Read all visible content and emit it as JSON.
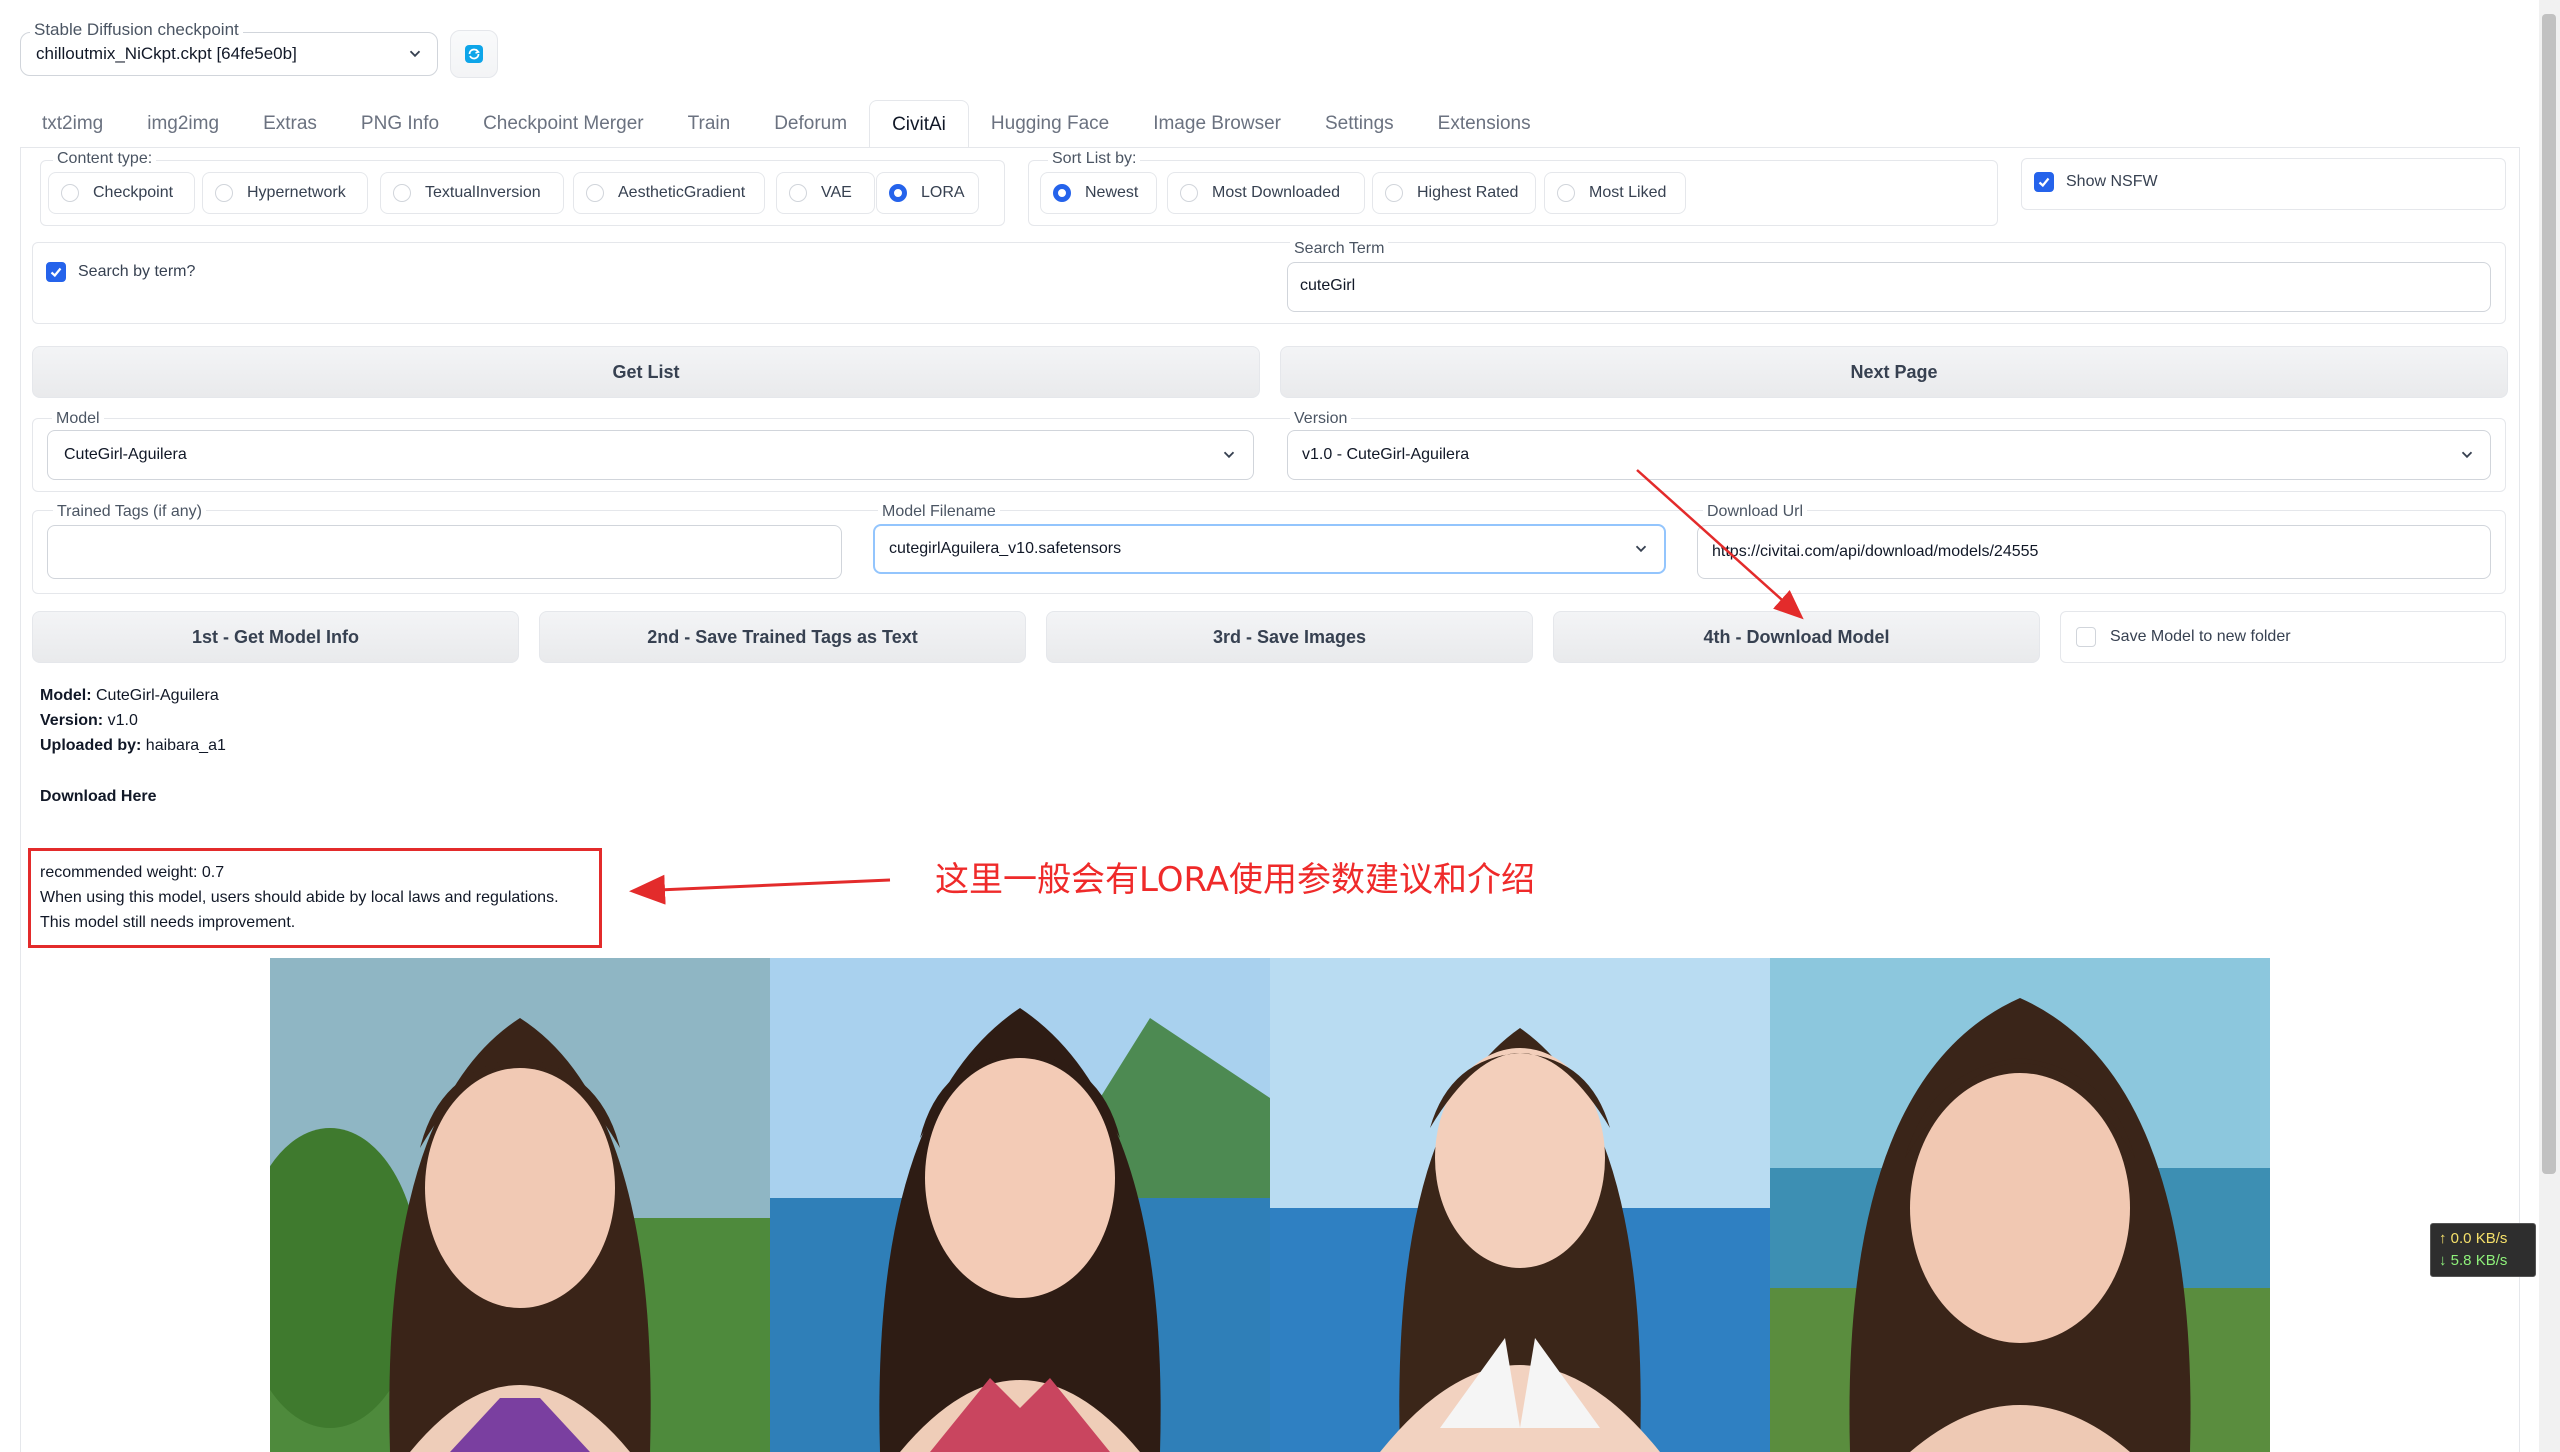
{
  "checkpoint": {
    "label": "Stable Diffusion checkpoint",
    "value": "chilloutmix_NiCkpt.ckpt [64fe5e0b]"
  },
  "tabs": [
    "txt2img",
    "img2img",
    "Extras",
    "PNG Info",
    "Checkpoint Merger",
    "Train",
    "Deforum",
    "CivitAi",
    "Hugging Face",
    "Image Browser",
    "Settings",
    "Extensions"
  ],
  "active_tab": "CivitAi",
  "content_type": {
    "label": "Content type:",
    "options": [
      "Checkpoint",
      "Hypernetwork",
      "TextualInversion",
      "AestheticGradient",
      "VAE",
      "LORA"
    ],
    "selected": "LORA"
  },
  "sort": {
    "label": "Sort List by:",
    "options": [
      "Newest",
      "Most Downloaded",
      "Highest Rated",
      "Most Liked"
    ],
    "selected": "Newest"
  },
  "show_nsfw": {
    "label": "Show NSFW",
    "checked": true
  },
  "search_by_term": {
    "label": "Search by term?",
    "checked": true
  },
  "search_term": {
    "label": "Search Term",
    "value": "cuteGirl"
  },
  "buttons": {
    "get_list": "Get List",
    "next_page": "Next Page"
  },
  "model": {
    "label": "Model",
    "value": "CuteGirl-Aguilera"
  },
  "version": {
    "label": "Version",
    "value": "v1.0 - CuteGirl-Aguilera"
  },
  "trained_tags": {
    "label": "Trained Tags (if any)",
    "value": ""
  },
  "model_filename": {
    "label": "Model Filename",
    "value": "cutegirlAguilera_v10.safetensors"
  },
  "download_url": {
    "label": "Download Url",
    "value": "https://civitai.com/api/download/models/24555"
  },
  "steps": {
    "step1": "1st - Get Model Info",
    "step2": "2nd - Save Trained Tags as Text",
    "step3": "3rd - Save Images",
    "step4": "4th - Download Model"
  },
  "save_new_folder": {
    "label": "Save Model to new folder",
    "checked": false
  },
  "model_info": {
    "model_key": "Model:",
    "model_val": "CuteGirl-Aguilera",
    "version_key": "Version:",
    "version_val": "v1.0",
    "uploader_key": "Uploaded by:",
    "uploader_val": "haibara_a1",
    "download_link": "Download Here"
  },
  "description": {
    "line1": "recommended weight: 0.7",
    "line2": "When using this model, users should abide by local laws and regulations.",
    "line3": "This model still needs improvement."
  },
  "annotation": "这里一般会有LORA使用参数建议和介绍",
  "net_speed": {
    "up": "0.0 KB/s",
    "down": "5.8 KB/s"
  },
  "colors": {
    "accent": "#2563eb",
    "annotation_red": "#e32b2b"
  },
  "preview_images": [
    "photo-1",
    "photo-2",
    "photo-3",
    "photo-4"
  ]
}
